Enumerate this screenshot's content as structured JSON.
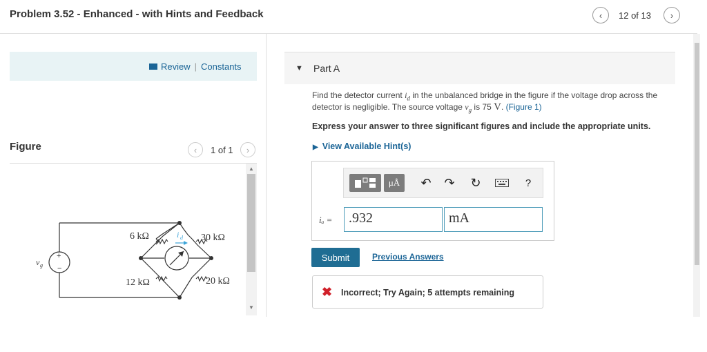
{
  "header": {
    "title": "Problem 3.52 - Enhanced - with Hints and Feedback",
    "count": "12 of 13",
    "prev_icon": "‹",
    "next_icon": "›"
  },
  "left": {
    "review": "Review",
    "constants": "Constants",
    "figure_label": "Figure",
    "figure_count": "1 of 1",
    "figure": {
      "r1": "6 kΩ",
      "r2": "30 kΩ",
      "r3": "12 kΩ",
      "r4": "20 kΩ",
      "current": "i",
      "current_sub": "d",
      "source": "v",
      "source_sub": "g",
      "plus": "+",
      "minus": "−"
    }
  },
  "part": {
    "label": "Part A",
    "question_1": "Find the detector current ",
    "var_i": "i",
    "var_i_sub": "d",
    "question_2": " in the unbalanced bridge in the figure if the voltage drop across the detector is negligible. The source voltage ",
    "var_v": "v",
    "var_v_sub": "g",
    "question_3": " is 75 ",
    "volt": "V",
    "question_4": ". ",
    "figure_link": "(Figure 1)",
    "instruction": "Express your answer to three significant figures and include the appropriate units.",
    "hint_link": "View Available Hint(s)"
  },
  "answer": {
    "var_label": "iₐ =",
    "value": ".932",
    "units": "mA",
    "units_btn": "μÅ",
    "help": "?"
  },
  "submit": "Submit",
  "previous_answers": "Previous Answers",
  "feedback": {
    "icon": "✖",
    "text": "Incorrect; Try Again; 5 attempts remaining"
  }
}
